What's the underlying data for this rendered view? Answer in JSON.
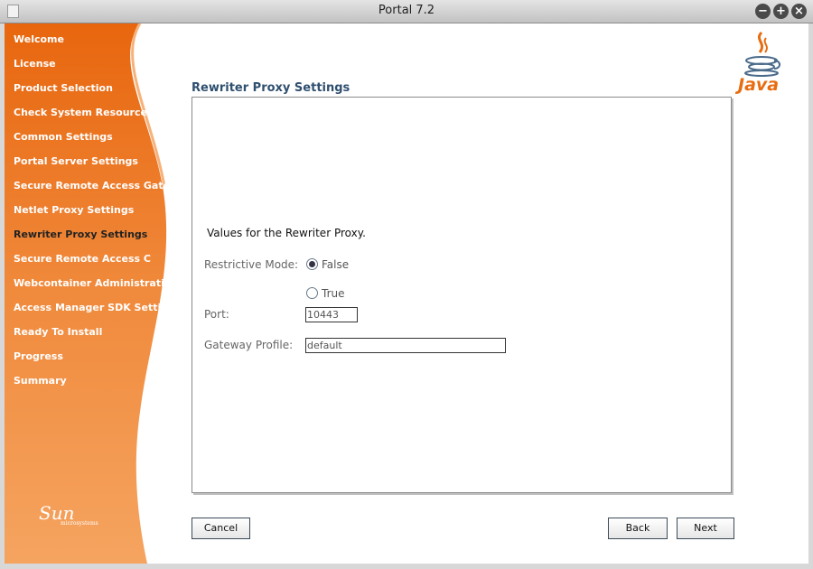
{
  "window": {
    "title": "Portal 7.2"
  },
  "sidebar": {
    "items": [
      {
        "label": "Welcome"
      },
      {
        "label": "License"
      },
      {
        "label": "Product Selection"
      },
      {
        "label": "Check System Resources"
      },
      {
        "label": "Common Settings"
      },
      {
        "label": "Portal Server Settings"
      },
      {
        "label": "Secure Remote Access Gatewa"
      },
      {
        "label": "Netlet Proxy Settings"
      },
      {
        "label": "Rewriter Proxy Settings"
      },
      {
        "label": "Secure Remote Access C"
      },
      {
        "label": "Webcontainer Administrati"
      },
      {
        "label": "Access Manager SDK Settin"
      },
      {
        "label": "Ready To Install"
      },
      {
        "label": "Progress"
      },
      {
        "label": "Summary"
      }
    ],
    "active_index": 8,
    "logo_text": "Sun",
    "logo_subtext": "microsystems"
  },
  "java_logo_text": "Java",
  "main": {
    "title": "Rewriter Proxy Settings",
    "intro": "Values for the Rewriter Proxy.",
    "restrictive_mode": {
      "label": "Restrictive Mode:",
      "options": [
        {
          "label": "False",
          "selected": true
        },
        {
          "label": "True",
          "selected": false
        }
      ]
    },
    "port": {
      "label": "Port:",
      "value": "10443"
    },
    "gateway_profile": {
      "label": "Gateway Profile:",
      "value": "default"
    }
  },
  "buttons": {
    "cancel": "Cancel",
    "back": "Back",
    "next": "Next"
  },
  "colors": {
    "sidebar_orange": "#e8761a",
    "title_blue": "#2f4f6f",
    "java_orange": "#e86c10"
  }
}
